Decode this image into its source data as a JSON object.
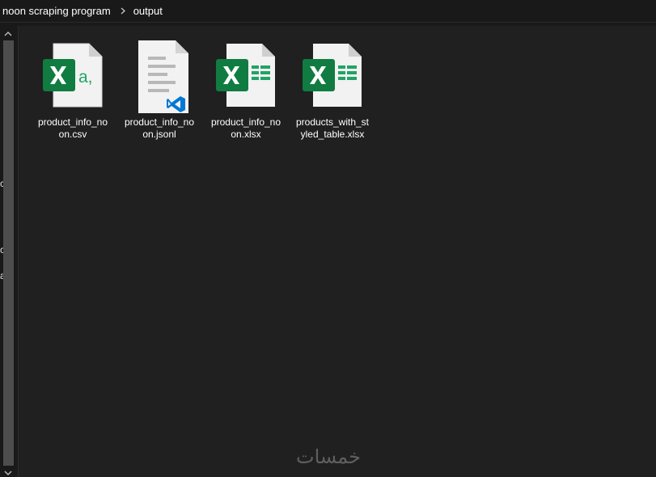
{
  "breadcrumb": {
    "items": [
      "noon scraping program",
      "output"
    ],
    "separator": "›"
  },
  "nav_pane": {
    "clipped_labels": [
      "c",
      "c",
      "a"
    ]
  },
  "files": [
    {
      "name": "product_info_noon.csv",
      "line1": "product_info_no",
      "line2": "on.csv",
      "icon": "excel-csv-icon"
    },
    {
      "name": "product_info_noon.jsonl",
      "line1": "product_info_no",
      "line2": "on.jsonl",
      "icon": "vscode-document-icon"
    },
    {
      "name": "product_info_noon.xlsx",
      "line1": "product_info_no",
      "line2": "on.xlsx",
      "icon": "excel-workbook-icon"
    },
    {
      "name": "products_with_styled_table.xlsx",
      "line1": "products_with_st",
      "line2": "yled_table.xlsx",
      "icon": "excel-workbook-icon"
    }
  ],
  "watermark": "خمسات",
  "colors": {
    "excel_green": "#107C41",
    "excel_accent": "#21A366",
    "vscode_blue": "#0078D4",
    "background": "#191919"
  }
}
